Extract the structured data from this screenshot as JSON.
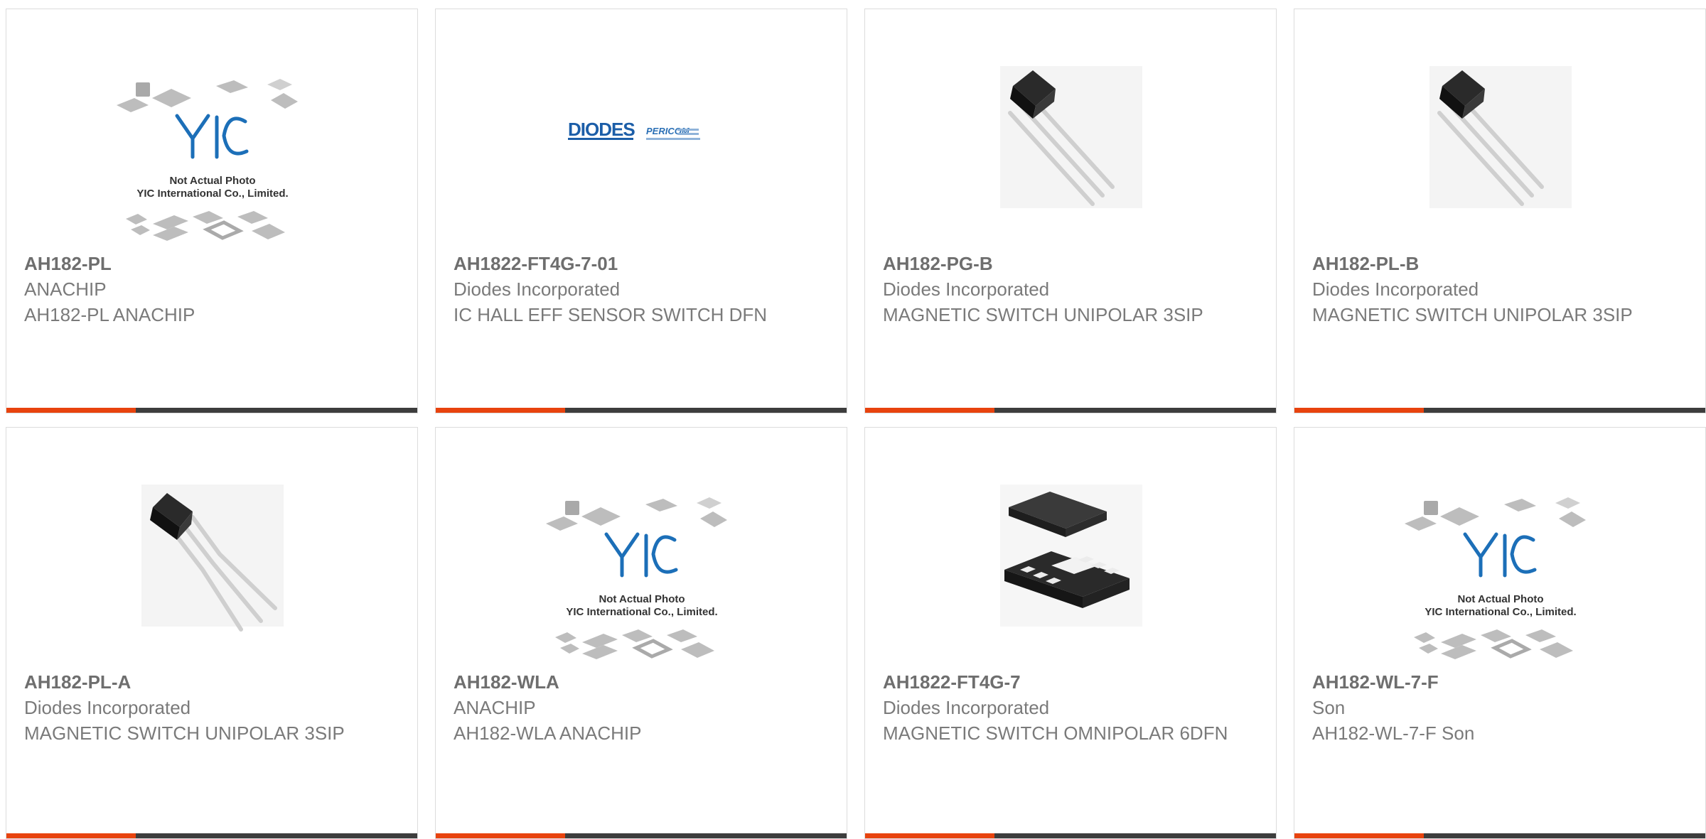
{
  "products": [
    {
      "part_number": "AH182-PL",
      "manufacturer": "ANACHIP",
      "description": "AH182-PL ANACHIP",
      "image": "placeholder-yic",
      "placeholder_text": [
        "Not Actual Photo",
        "YIC International Co., Limited."
      ]
    },
    {
      "part_number": "AH1822-FT4G-7-01",
      "manufacturer": "Diodes Incorporated",
      "description": "IC HALL EFF SENSOR SWITCH DFN",
      "image": "diodes-logo",
      "logo_text": [
        "DIODES",
        "PERICOM"
      ]
    },
    {
      "part_number": "AH182-PG-B",
      "manufacturer": "Diodes Incorporated",
      "description": "MAGNETIC SWITCH UNIPOLAR 3SIP",
      "image": "to92-component"
    },
    {
      "part_number": "AH182-PL-B",
      "manufacturer": "Diodes Incorporated",
      "description": "MAGNETIC SWITCH UNIPOLAR 3SIP",
      "image": "to92-component"
    },
    {
      "part_number": "AH182-PL-A",
      "manufacturer": "Diodes Incorporated",
      "description": "MAGNETIC SWITCH UNIPOLAR 3SIP",
      "image": "to92-component-bent"
    },
    {
      "part_number": "AH182-WLA",
      "manufacturer": "ANACHIP",
      "description": "AH182-WLA ANACHIP",
      "image": "placeholder-yic",
      "placeholder_text": [
        "Not Actual Photo",
        "YIC International Co., Limited."
      ]
    },
    {
      "part_number": "AH1822-FT4G-7",
      "manufacturer": "Diodes Incorporated",
      "description": "MAGNETIC SWITCH OMNIPOLAR 6DFN",
      "image": "dfn-package"
    },
    {
      "part_number": "AH182-WL-7-F",
      "manufacturer": "Son",
      "description": "AH182-WL-7-F Son",
      "image": "placeholder-yic",
      "placeholder_text": [
        "Not Actual Photo",
        "YIC International Co., Limited."
      ]
    }
  ],
  "colors": {
    "accent": "#e8430e",
    "bar_dark": "#3d3d3d",
    "text": "#7a7a7a",
    "logo_blue": "#1c6fb8"
  }
}
